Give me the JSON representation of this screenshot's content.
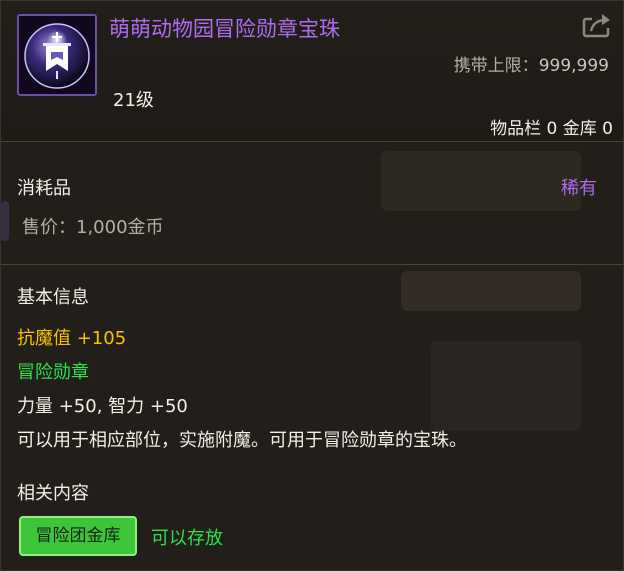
{
  "item": {
    "name": "萌萌动物园冒险勋章宝珠",
    "level": "21级",
    "carry_limit_label": "携带上限：",
    "carry_limit_value": "999,999",
    "storage": "物品栏 0 金库 0",
    "icon": "banner-orb-icon",
    "name_color": "#b06bf0"
  },
  "header": {
    "share_icon": "share-export-icon"
  },
  "info": {
    "category": "消耗品",
    "rarity": "稀有",
    "rarity_color": "#b06bf0",
    "price": "售价：1,000金币"
  },
  "basic": {
    "title": "基本信息",
    "magic_resist": "抗魔值 +105",
    "tag": "冒险勋章",
    "stats": "力量 +50, 智力 +50",
    "description": "可以用于相应部位，实施附魔。可用于冒险勋章的宝珠。"
  },
  "related": {
    "title": "相关内容",
    "button": "冒险团金库",
    "status": "可以存放"
  }
}
